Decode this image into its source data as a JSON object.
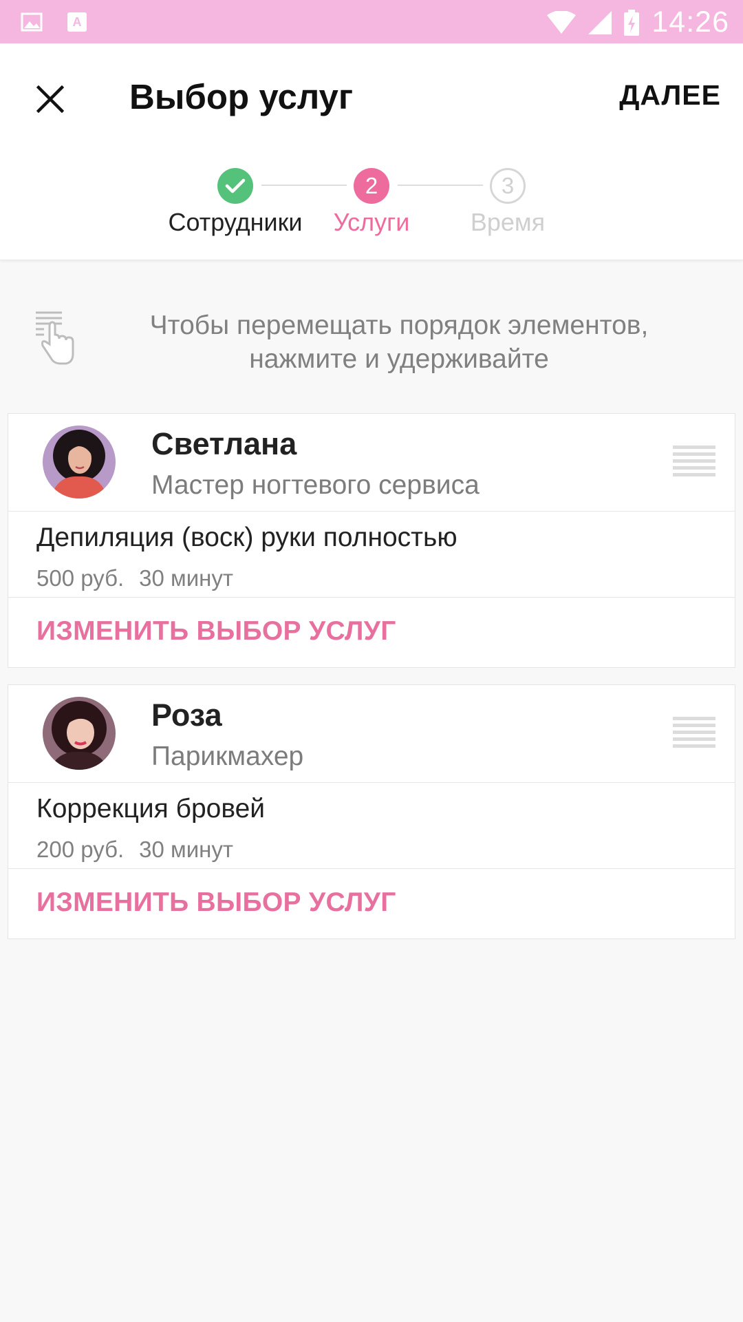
{
  "status_bar": {
    "time": "14:26",
    "background": "#f5b6df"
  },
  "header": {
    "title": "Выбор услуг",
    "next_label": "ДАЛЕЕ"
  },
  "steps": [
    {
      "number": "1",
      "label": "Сотрудники",
      "state": "done",
      "color": "#55c27b"
    },
    {
      "number": "2",
      "label": "Услуги",
      "state": "active",
      "color": "#ed6b9d"
    },
    {
      "number": "3",
      "label": "Время",
      "state": "pending",
      "color": "#d6d6d6"
    }
  ],
  "hint": {
    "text": "Чтобы перемещать порядок элементов, нажмите и удерживайте"
  },
  "cards": [
    {
      "name": "Светлана",
      "role": "Мастер ногтевого сервиса",
      "service": {
        "name": "Депиляция (воск) руки полностью",
        "price": "500 руб.",
        "duration": "30 минут"
      },
      "change_label": "ИЗМЕНИТЬ ВЫБОР УСЛУГ"
    },
    {
      "name": "Роза",
      "role": "Парикмахер",
      "service": {
        "name": "Коррекция бровей",
        "price": "200 руб.",
        "duration": "30 минут"
      },
      "change_label": "ИЗМЕНИТЬ ВЫБОР УСЛУГ"
    }
  ],
  "colors": {
    "accent": "#e8709f",
    "success": "#55c27b",
    "muted": "#808080"
  }
}
